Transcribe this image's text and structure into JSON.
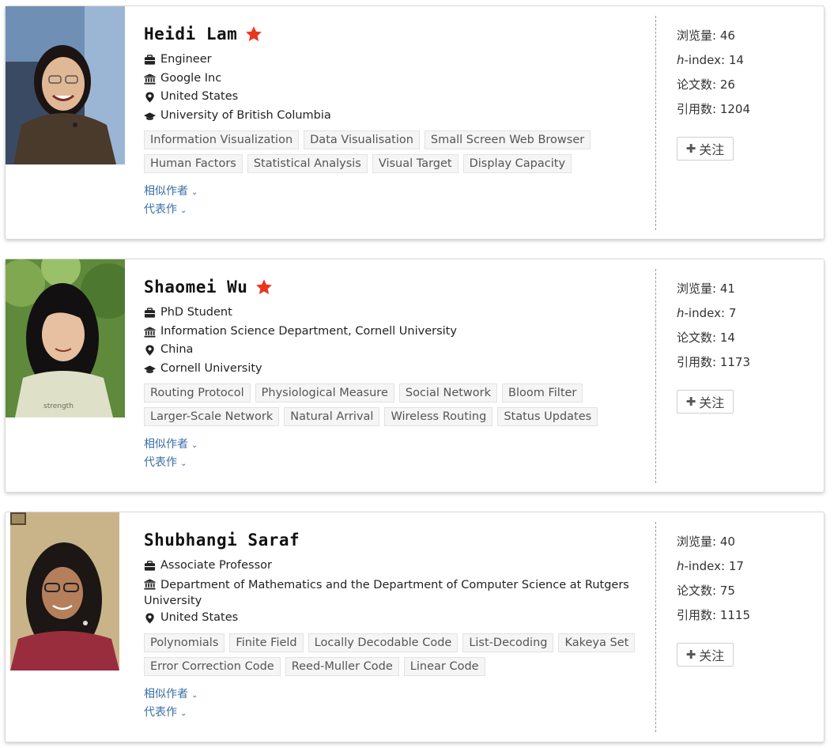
{
  "cards": [
    {
      "name": "Heidi Lam",
      "starred": true,
      "position": "Engineer",
      "affiliation": "Google Inc",
      "country": "United States",
      "education": "University of British Columbia",
      "tags": [
        "Information Visualization",
        "Data Visualisation",
        "Small Screen Web Browser",
        "Human Factors",
        "Statistical Analysis",
        "Visual Target",
        "Display Capacity"
      ],
      "similar_authors": "相似作者",
      "representative_works": "代表作",
      "stats": {
        "views_label": "浏览量:",
        "views": "46",
        "hindex_h": "h",
        "hindex_label": "-index:",
        "hindex": "14",
        "papers_label": "论文数:",
        "papers": "26",
        "citations_label": "引用数:",
        "citations": "1204"
      },
      "follow_label": "关注"
    },
    {
      "name": "Shaomei Wu",
      "starred": true,
      "position": "PhD Student",
      "affiliation": "Information Science Department, Cornell University",
      "country": "China",
      "education": "Cornell University",
      "tags": [
        "Routing Protocol",
        "Physiological Measure",
        "Social Network",
        "Bloom Filter",
        "Larger-Scale Network",
        "Natural Arrival",
        "Wireless Routing",
        "Status Updates"
      ],
      "similar_authors": "相似作者",
      "representative_works": "代表作",
      "stats": {
        "views_label": "浏览量:",
        "views": "41",
        "hindex_h": "h",
        "hindex_label": "-index:",
        "hindex": "7",
        "papers_label": "论文数:",
        "papers": "14",
        "citations_label": "引用数:",
        "citations": "1173"
      },
      "follow_label": "关注"
    },
    {
      "name": "Shubhangi Saraf",
      "starred": false,
      "position": "Associate Professor",
      "affiliation_line1": "Department of Mathematics and the Department of Computer Science at Rutgers",
      "affiliation_line2": "University",
      "country": "United States",
      "tags": [
        "Polynomials",
        "Finite Field",
        "Locally Decodable Code",
        "List-Decoding",
        "Kakeya Set",
        "Error Correction Code",
        "Reed-Muller Code",
        "Linear Code"
      ],
      "similar_authors": "相似作者",
      "representative_works": "代表作",
      "stats": {
        "views_label": "浏览量:",
        "views": "40",
        "hindex_h": "h",
        "hindex_label": "-index:",
        "hindex": "17",
        "papers_label": "论文数:",
        "papers": "75",
        "citations_label": "引用数:",
        "citations": "1115"
      },
      "follow_label": "关注"
    }
  ],
  "icons": {
    "star": "star-icon",
    "position": "briefcase-icon",
    "affiliation": "institution-icon",
    "country": "location-pin-icon",
    "education": "graduation-cap-icon",
    "chevron": "chevron-down-icon",
    "plus": "plus-icon"
  },
  "colors": {
    "star": "#e8361e",
    "link": "#3a6ea5",
    "tag_bg": "#f5f5f5"
  }
}
